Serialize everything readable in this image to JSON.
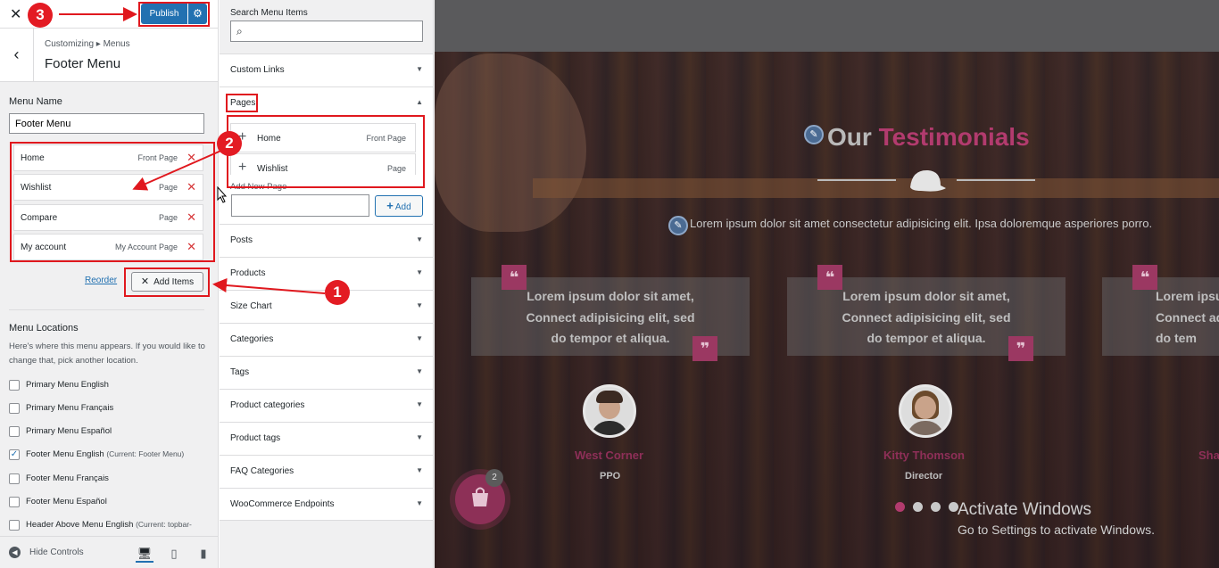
{
  "topbar": {
    "close_glyph": "✕",
    "publish_label": "Publish",
    "settings_glyph": "⚙"
  },
  "header": {
    "back_glyph": "‹",
    "breadcrumb": "Customizing ▸ Menus",
    "title": "Footer Menu"
  },
  "menu_name": {
    "label": "Menu Name",
    "value": "Footer Menu"
  },
  "menu_items": [
    {
      "label": "Home",
      "type": "Front Page"
    },
    {
      "label": "Wishlist",
      "type": "Page"
    },
    {
      "label": "Compare",
      "type": "Page"
    },
    {
      "label": "My account",
      "type": "My Account Page"
    }
  ],
  "remove_glyph": "✕",
  "actions": {
    "reorder_label": "Reorder",
    "add_items_label": "Add Items",
    "add_items_glyph": "✕"
  },
  "locations": {
    "title": "Menu Locations",
    "description": "Here's where this menu appears. If you would like to change that, pick another location.",
    "items": [
      {
        "label": "Primary Menu English",
        "note": "",
        "checked": false
      },
      {
        "label": "Primary Menu Français",
        "note": "",
        "checked": false
      },
      {
        "label": "Primary Menu Español",
        "note": "",
        "checked": false
      },
      {
        "label": "Footer Menu English",
        "note": "(Current: Footer Menu)",
        "checked": true
      },
      {
        "label": "Footer Menu Français",
        "note": "",
        "checked": false
      },
      {
        "label": "Footer Menu Español",
        "note": "",
        "checked": false
      },
      {
        "label": "Header Above Menu English",
        "note": "(Current: topbar-",
        "checked": false
      }
    ]
  },
  "bottombar": {
    "hide_label": "Hide Controls"
  },
  "add_panel": {
    "search_label": "Search Menu Items",
    "search_placeholder": "",
    "sections_top": [
      "Custom Links"
    ],
    "pages": {
      "label": "Pages",
      "items": [
        {
          "label": "Home",
          "type": "Front Page"
        },
        {
          "label": "Wishlist",
          "type": "Page"
        }
      ],
      "add_new_label": "Add New Page",
      "add_button": "Add"
    },
    "sections_bottom": [
      "Posts",
      "Products",
      "Size Chart",
      "Categories",
      "Tags",
      "Product categories",
      "Product tags",
      "FAQ Categories",
      "WooCommerce Endpoints"
    ],
    "collapsed_arrow": "▼",
    "expanded_arrow": "▲"
  },
  "preview": {
    "title_part1": "Our",
    "title_part2": "Testimonials",
    "subtitle": "Lorem ipsum dolor sit amet consectetur adipisicing elit. Ipsa doloremque asperiores porro.",
    "cards": [
      {
        "line1": "Lorem ipsum dolor sit amet,",
        "line2": "Connect adipisicing elit, sed",
        "line3": "do tempor et aliqua."
      },
      {
        "line1": "Lorem ipsum dolor sit amet,",
        "line2": "Connect adipisicing elit, sed",
        "line3": "do tempor et aliqua."
      },
      {
        "line1": "Lorem ipsum",
        "line2": "Connect ad",
        "line3": "do tem"
      }
    ],
    "people": [
      {
        "name": "West Corner",
        "role": "PPO"
      },
      {
        "name": "Kitty Thomson",
        "role": "Director"
      },
      {
        "name": "Sha",
        "role": ""
      }
    ],
    "cart_count": "2",
    "active_dot": 0,
    "dot_count": 4,
    "watermark_title": "Activate Windows",
    "watermark_sub": "Go to Settings to activate Windows.",
    "accent_color": "#b23b6e"
  },
  "annotations": [
    "1",
    "2",
    "3"
  ]
}
